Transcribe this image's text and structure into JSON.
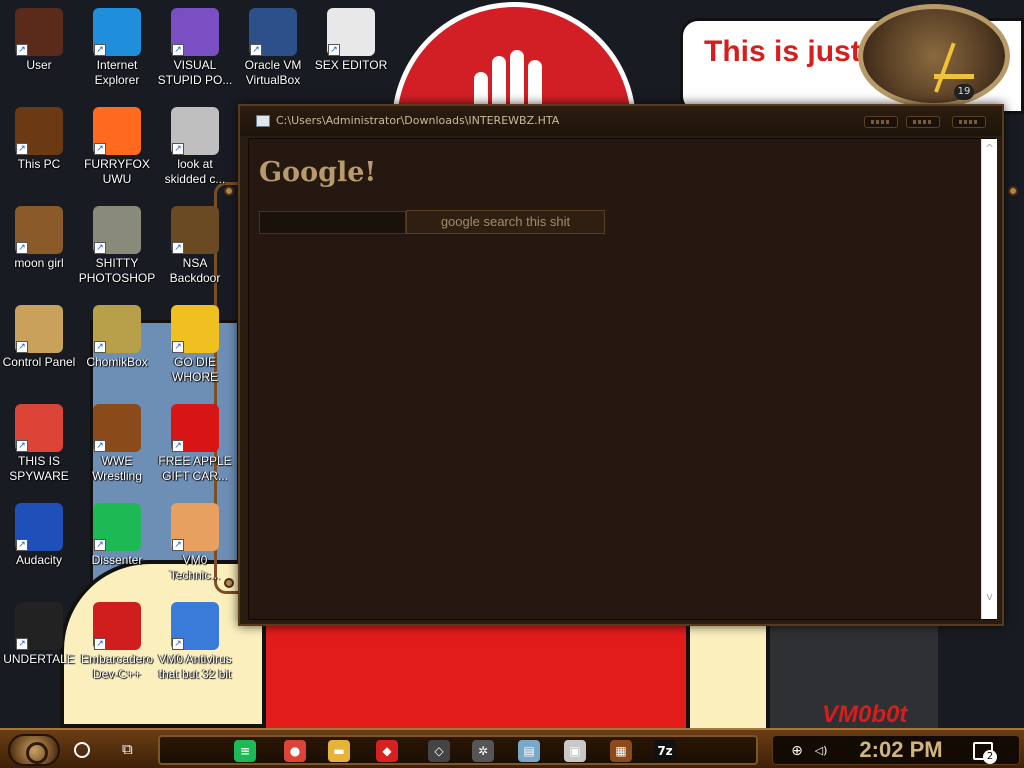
{
  "wallpaper": {
    "note_text": "This is just George Orwell",
    "brand_text": "VM0b0t",
    "clock_numeral": "19"
  },
  "desktop_icons": [
    {
      "label": "User",
      "icon": "user-figure-icon",
      "color": "#5a2a1a"
    },
    {
      "label": "Internet Explorer",
      "icon": "edge-browser-icon",
      "color": "#1f8fdc"
    },
    {
      "label": "VISUAL STUPID PO...",
      "icon": "visual-studio-icon",
      "color": "#7a4fc4"
    },
    {
      "label": "Oracle VM VirtualBox",
      "icon": "virtualbox-cube-icon",
      "color": "#2d4f8a"
    },
    {
      "label": "SEX EDITOR",
      "icon": "hex-editor-icon",
      "color": "#e8e8e8"
    },
    {
      "label": "This PC",
      "icon": "computer-icon",
      "color": "#6a3a12"
    },
    {
      "label": "FURRYFOX UWU",
      "icon": "firefox-icon",
      "color": "#ff6a1f"
    },
    {
      "label": "look at skidded c...",
      "icon": "stacked-windows-icon",
      "color": "#bfbfbf"
    },
    {
      "label": "moon girl",
      "icon": "wooden-box-icon",
      "color": "#8a5a28"
    },
    {
      "label": "SHITTY PHOTOSHOP",
      "icon": "gimp-icon",
      "color": "#8a8a7a"
    },
    {
      "label": "NSA Backdoor",
      "icon": "brass-gadget-icon",
      "color": "#6a4a22"
    },
    {
      "label": "Control Panel",
      "icon": "lightbulb-icon",
      "color": "#c9a15a"
    },
    {
      "label": "ChomikBox",
      "icon": "hamster-box-icon",
      "color": "#b8a04a"
    },
    {
      "label": "GO DIE WHORE",
      "icon": "de-letters-icon",
      "color": "#f0c020"
    },
    {
      "label": "THIS IS SPYWARE",
      "icon": "chrome-icon",
      "color": "#db4437"
    },
    {
      "label": "WWE Wrestling",
      "icon": "retro-oven-icon",
      "color": "#8a4a1a"
    },
    {
      "label": "FREE APPLE GIFT CAR...",
      "icon": "red-apple-icon",
      "color": "#d81414"
    },
    {
      "label": "Audacity",
      "icon": "headphones-waveform-icon",
      "color": "#1f4fb8"
    },
    {
      "label": "Dissenter",
      "icon": "spotify-like-icon",
      "color": "#1db954"
    },
    {
      "label": "VM0 Technic...",
      "icon": "doctor-avatar-icon",
      "color": "#e8a060"
    },
    {
      "label": "UNDERTALE",
      "icon": "unity-logo-icon",
      "color": "#222222"
    },
    {
      "label": "Embarcadero Dev-C++",
      "icon": "devcpp-icon",
      "color": "#d01e1e"
    },
    {
      "label": "VM0 Antivirus that but 32 bit",
      "icon": "windows-shield-icon",
      "color": "#3a7ad8"
    }
  ],
  "hta_window": {
    "title": "C:\\Users\\Administrator\\Downloads\\INTEREWBZ.HTA",
    "heading": "Google!",
    "search_value": "",
    "button_label": "google search this shit",
    "scroll_up": "^",
    "scroll_down": "v"
  },
  "taskbar": {
    "pinned_apps": [
      {
        "icon": "dissenter-taskbar-icon",
        "glyph": "≡",
        "color": "#1db954"
      },
      {
        "icon": "chrome-taskbar-icon",
        "glyph": "●",
        "color": "#db4437"
      },
      {
        "icon": "folder-taskbar-icon",
        "glyph": "▬",
        "color": "#e6b33a"
      },
      {
        "icon": "unknown-red-app-icon",
        "glyph": "◆",
        "color": "#d82020"
      },
      {
        "icon": "unity-taskbar-icon",
        "glyph": "◇",
        "color": "#444444"
      },
      {
        "icon": "gear-taskbar-icon",
        "glyph": "✲",
        "color": "#555555"
      },
      {
        "icon": "notepad-taskbar-icon",
        "glyph": "▤",
        "color": "#7aa8c8"
      },
      {
        "icon": "picture-taskbar-icon",
        "glyph": "▣",
        "color": "#c8c8c8"
      },
      {
        "icon": "oven-taskbar-icon",
        "glyph": "▦",
        "color": "#8a4a1a"
      },
      {
        "icon": "7zip-taskbar-icon",
        "glyph": "7z",
        "color": "#111111"
      }
    ],
    "clock": "2:02 PM",
    "notification_count": "2",
    "network_glyph": "⊕",
    "volume_glyph": "◁)"
  }
}
